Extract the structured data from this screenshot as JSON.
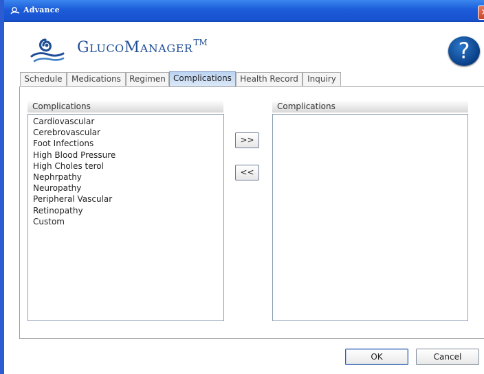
{
  "window": {
    "title": "Advance",
    "close_glyph": "✕"
  },
  "brand": {
    "name_cap1": "G",
    "name_part1": "LUCO",
    "name_cap2": "M",
    "name_part2": "ANAGER",
    "trademark": "TM",
    "logo_icon": "glucomanager-logo-icon"
  },
  "help": {
    "glyph": "?",
    "icon": "help-icon"
  },
  "tabs": [
    {
      "label": "Schedule"
    },
    {
      "label": "Medications"
    },
    {
      "label": "Regimen"
    },
    {
      "label": "Complications"
    },
    {
      "label": "Health Record"
    },
    {
      "label": "Inquiry"
    }
  ],
  "active_tab": "Complications",
  "available": {
    "header": "Complications",
    "items": [
      "Cardiovascular",
      "Cerebrovascular",
      "Foot Infections",
      "High Blood Pressure",
      "High Choles terol",
      "Nephrpathy",
      "Neuropathy",
      "Peripheral Vascular",
      "Retinopathy",
      "Custom"
    ]
  },
  "selected": {
    "header": "Complications",
    "items": []
  },
  "move": {
    "add_label": ">>",
    "remove_label": "<<"
  },
  "footer": {
    "ok_label": "OK",
    "cancel_label": "Cancel"
  },
  "colors": {
    "title_bar": "#1c5bd8",
    "brand_text": "#1f4e95",
    "active_tab": "#c9dcf4"
  }
}
